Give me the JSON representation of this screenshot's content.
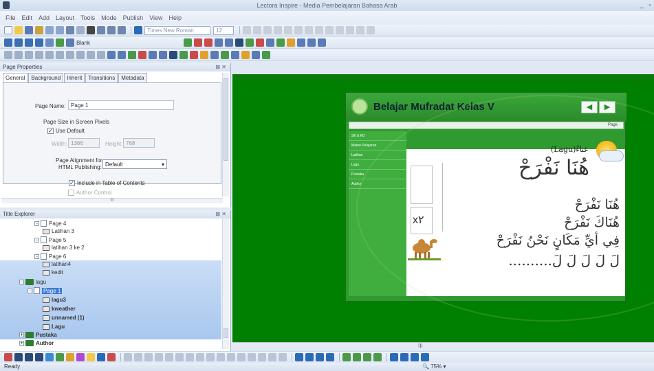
{
  "window": {
    "title": "Lectora Inspire - Media Pembelajaran Bahasa Arab",
    "minimize": "_",
    "restore": "▫"
  },
  "menu": [
    "File",
    "Edit",
    "Add",
    "Layout",
    "Tools",
    "Mode",
    "Publish",
    "View",
    "Help"
  ],
  "toolbar": {
    "font": "Times New Roman",
    "size": "12",
    "blank_label": "Blank"
  },
  "page_properties": {
    "title": "Page Properties",
    "close": "⊠ ✕",
    "tabs": [
      "General",
      "Background",
      "Inherit",
      "Transitions",
      "Metadata"
    ],
    "active_tab": "General",
    "page_name_label": "Page Name:",
    "page_name": "Page 1",
    "page_size_label": "Page Size in Screen Pixels",
    "use_default_label": "Use Default",
    "use_default_checked": true,
    "width_label": "Width:",
    "width": "1366",
    "height_label": "Height:",
    "height": "768",
    "alignment_label_1": "Page Alignment for",
    "alignment_label_2": "HTML Publishing:",
    "alignment_value": "Default",
    "include_toc_label": "Include in Table of Contents",
    "include_toc_checked": true,
    "author_control_label": "Author Control",
    "scroll_dots": "III"
  },
  "title_explorer": {
    "title": "Title Explorer",
    "close": "⊠ ✕",
    "items": [
      {
        "label": "Page 4",
        "kind": "page",
        "indent": 4,
        "expander": "−"
      },
      {
        "label": "Latihan 3",
        "kind": "action",
        "indent": 7
      },
      {
        "label": "Page 5",
        "kind": "page",
        "indent": 4,
        "expander": "−"
      },
      {
        "label": "latihan 3 ke 2",
        "kind": "action",
        "indent": 7
      },
      {
        "label": "Page 6",
        "kind": "page",
        "indent": 4,
        "expander": "−"
      },
      {
        "label": "latihan4",
        "kind": "action",
        "indent": 7
      },
      {
        "label": "kedit",
        "kind": "action",
        "indent": 7
      },
      {
        "label": "lagu",
        "kind": "folder",
        "indent": 2,
        "expander": "−"
      },
      {
        "label": "Page 1",
        "kind": "page",
        "indent": 4,
        "expander": "−",
        "selected": true
      },
      {
        "label": "lagu3",
        "kind": "action",
        "indent": 7
      },
      {
        "label": "kweather",
        "kind": "action",
        "indent": 7
      },
      {
        "label": "unnamed (1)",
        "kind": "action",
        "indent": 7
      },
      {
        "label": "Lagu",
        "kind": "action",
        "indent": 7
      },
      {
        "label": "Pustaka",
        "kind": "folder",
        "indent": 2,
        "expander": "+"
      },
      {
        "label": "Author",
        "kind": "folder",
        "indent": 2,
        "expander": "+"
      }
    ]
  },
  "slide": {
    "title": "Belajar Mufradat Kelas V",
    "strip_label": "Page",
    "nav_prev": "◀",
    "nav_next": "▶",
    "menu": [
      "SK & KD",
      "Materi Pelajaran",
      "Latihan",
      "Lagu",
      "Pustaka",
      "Author"
    ],
    "lagu_label": "(Lagu)غناءٌ",
    "heading_arabic": "هُنَا نَفْرَحْ",
    "lines": [
      "هُنَا نَفْرَحْ",
      "هُنَاكَ نَفْرَحْ",
      "فِي أيِّ مَكَانٍ نَحْنُ نَفْرَحْ",
      "لَ لَ لَ لَ لَ.........."
    ],
    "repeat_marker": "x٢"
  },
  "hscroll_label": "III",
  "status": {
    "text": "Ready",
    "zoom": "75%"
  }
}
